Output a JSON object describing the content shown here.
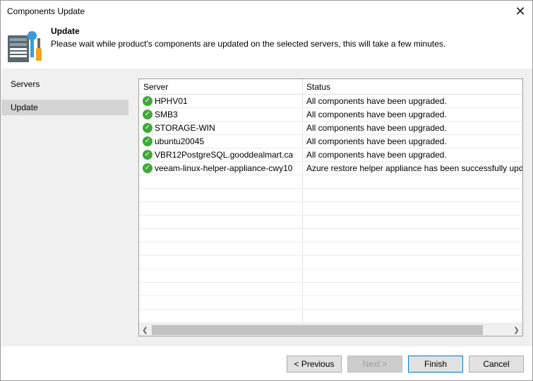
{
  "window": {
    "title": "Components Update",
    "close_label": "✕"
  },
  "header": {
    "title": "Update",
    "description": "Please wait while product's components are updated on the selected servers, this will take a few minutes."
  },
  "nav": {
    "items": [
      {
        "label": "Servers",
        "active": false
      },
      {
        "label": "Update",
        "active": true
      }
    ]
  },
  "table": {
    "columns": [
      "Server",
      "Status"
    ],
    "rows": [
      {
        "server": "HPHV01",
        "status": "All components have been upgraded."
      },
      {
        "server": "SMB3",
        "status": "All components have been upgraded."
      },
      {
        "server": "STORAGE-WIN",
        "status": "All components have been upgraded."
      },
      {
        "server": "ubuntu20045",
        "status": "All components have been upgraded."
      },
      {
        "server": "VBR12PostgreSQL.gooddealmart.ca",
        "status": "All components have been upgraded."
      },
      {
        "server": "veeam-linux-helper-appliance-cwy10",
        "status": "Azure restore helper appliance has been successfully updat"
      }
    ]
  },
  "scroll": {
    "left_arrow": "❮",
    "right_arrow": "❯"
  },
  "buttons": {
    "previous": "< Previous",
    "next": "Next >",
    "finish": "Finish",
    "cancel": "Cancel"
  }
}
